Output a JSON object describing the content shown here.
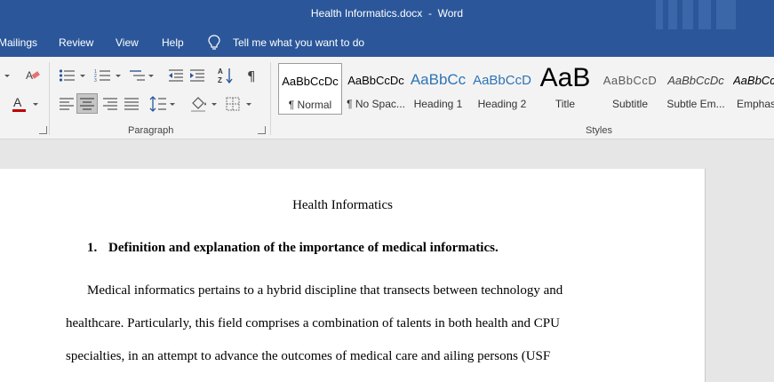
{
  "titlebar": {
    "document": "Health Informatics.docx",
    "separator": "-",
    "app": "Word"
  },
  "menu": {
    "tabs": [
      "Mailings",
      "Review",
      "View",
      "Help"
    ],
    "tell_me": "Tell me what you want to do"
  },
  "ribbon": {
    "paragraph_label": "Paragraph",
    "styles_label": "Styles",
    "styles": [
      {
        "sample": "AaBbCcDc",
        "name": "¶ Normal"
      },
      {
        "sample": "AaBbCcDc",
        "name": "¶ No Spac..."
      },
      {
        "sample": "AaBbCc",
        "name": "Heading 1"
      },
      {
        "sample": "AaBbCcD",
        "name": "Heading 2"
      },
      {
        "sample": "AaB",
        "name": "Title"
      },
      {
        "sample": "AaBbCcD",
        "name": "Subtitle"
      },
      {
        "sample": "AaBbCcDc",
        "name": "Subtle Em..."
      },
      {
        "sample": "AaBbCcDc",
        "name": "Emphas"
      }
    ],
    "selected_style": "Normal",
    "font_color": "#c00000",
    "accent": "#2b579a"
  },
  "document": {
    "title": "Health Informatics",
    "heading_number": "1.",
    "heading_text": "Definition and explanation of the importance of medical informatics.",
    "lines": [
      "Medical informatics pertains to a hybrid discipline that transects between technology and",
      "healthcare. Particularly, this field comprises a combination of talents in both health and CPU",
      "specialties, in an attempt to advance the outcomes of medical care and ailing persons (USF"
    ]
  }
}
